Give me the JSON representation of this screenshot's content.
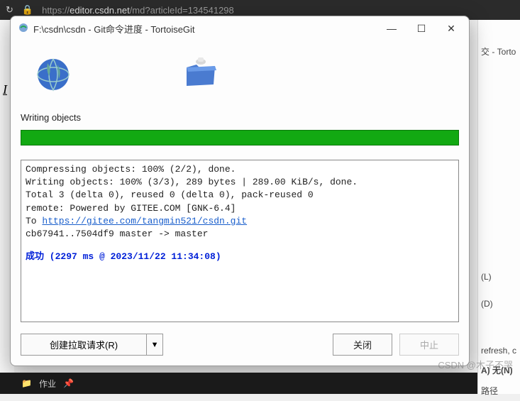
{
  "browser": {
    "url_prefix": "https://",
    "url_host": "editor.csdn.net",
    "url_path": "/md?articleId=134541298"
  },
  "bg": {
    "tab_suffix": "交 - Torto",
    "shortcut_l": "(L)",
    "shortcut_d": "(D)",
    "refresh": "refresh, c",
    "none": "无(N)",
    "path": "路径",
    "bold_a": "A)"
  },
  "taskbar": {
    "folder_label": "作业"
  },
  "watermark": "CSDN @木子不哭",
  "dialog": {
    "title": "F:\\csdn\\csdn - Git命令进度 - TortoiseGit",
    "status": "Writing objects",
    "log": {
      "l1": "Compressing objects: 100% (2/2), done.",
      "l2": "Writing objects: 100% (3/3), 289 bytes | 289.00 KiB/s, done.",
      "l3": "Total 3 (delta 0), reused 0 (delta 0), pack-reused 0",
      "l4": "remote: Powered by GITEE.COM [GNK-6.4]",
      "l5_prefix": "To ",
      "l5_link": "https://gitee.com/tangmin521/csdn.git",
      "l6": "cb67941..7504df9  master -> master",
      "success": "成功 (2297 ms @ 2023/11/22 11:34:08)"
    },
    "buttons": {
      "pull_request": "创建拉取请求(R)",
      "close": "关闭",
      "abort": "中止"
    }
  }
}
